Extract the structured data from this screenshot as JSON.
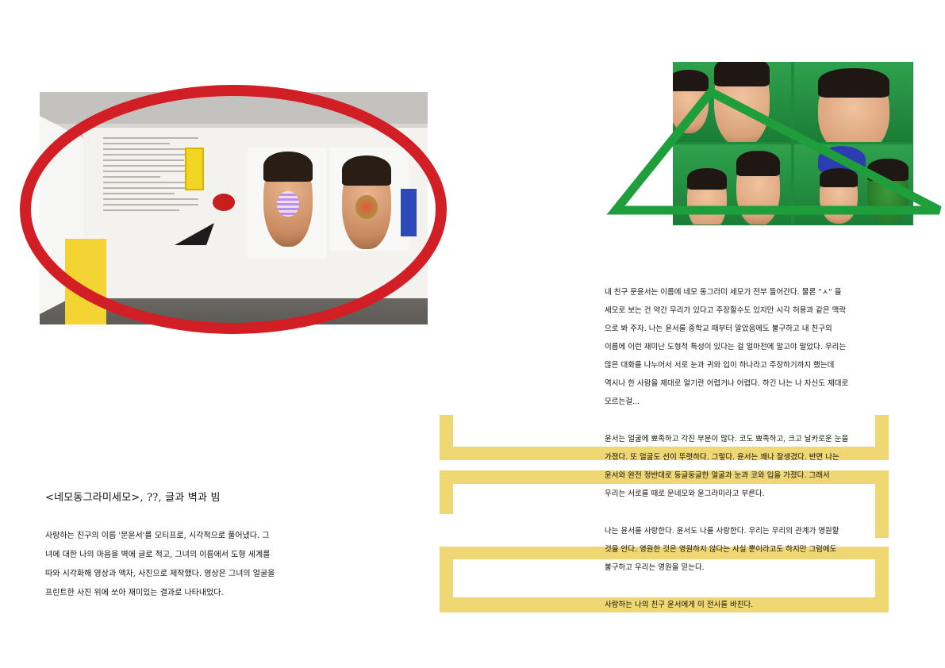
{
  "left_page": {
    "work_title": "<네모동그라미세모>, ??, 글과 벽과 빔",
    "description_lines": [
      "사랑하는 친구의 이름 '문윤서'를 모티프로, 시각적으로 풀어냈다. 그",
      "녀에 대한 나의 마음을 벽에 글로 적고, 그녀의 이름에서 도형 세계를",
      "따와 시각화해 영상과 액자, 사진으로 제작했다. 영상은 그녀의 얼굴을",
      "프린트한 사진 위에 쏘아 재미있는 결과로 나타내었다."
    ]
  },
  "right_page": {
    "essay": {
      "p1": [
        "내 친구 문윤서는 이름에 네모 동그라미 세모가 전부 들어간다. 물론 \"ㅅ\" 을",
        "세모로 보는 건 약간 무리가 있다고 주장할수도 있지만 시각 허용과 같은 맥락",
        "으로 봐 주자. 나는 윤서를 중학교 때부터 알았음에도 불구하고 내 친구의",
        "이름에 이런 재미난 도형적 특성이 있다는 걸 얼마전에 알고야 말았다. 우리는",
        "많은 대화를 나누어서 서로 눈과 귀와 입이 하나라고 주장하기까지 했는데",
        "역시나 한 사람을 제대로 알기란 어렵거나 어렵다. 하긴 나는 나 자신도 제대로",
        "모르는걸..."
      ],
      "p2": [
        " 윤서는 얼굴에 뾰족하고 각진 부분이 많다. 코도 뾰족하고, 크고 날카로운 눈을",
        "가졌다. 또 얼굴도 선이 뚜렷하다. 그렇다. 윤서는 꽤나 잘생겼다. 반면 나는",
        "윤서와 완전 정반대로 둥글둥글한 얼굴과 눈과 코와 입을 가졌다. 그래서",
        "우리는 서로를 때로 문네모와 윤그라미라고 부른다."
      ],
      "p3": [
        " 나는 윤서를 사랑한다. 윤서도 나를 사랑한다. 우리는 우리의 관계가 영원할",
        "것을 안다. 영원한 것은 영원하지 않다는 사실 뿐이라고도 하지만 그럼에도",
        "불구하고 우리는 영원을 믿는다."
      ],
      "p4": [
        " 사랑하는 나의 친구 윤서에게 이 전시를 바친다."
      ]
    }
  },
  "colors": {
    "ellipse_red": "#d21f26",
    "triangle_green": "#1f9e3c",
    "band_yellow": "#efd774"
  }
}
